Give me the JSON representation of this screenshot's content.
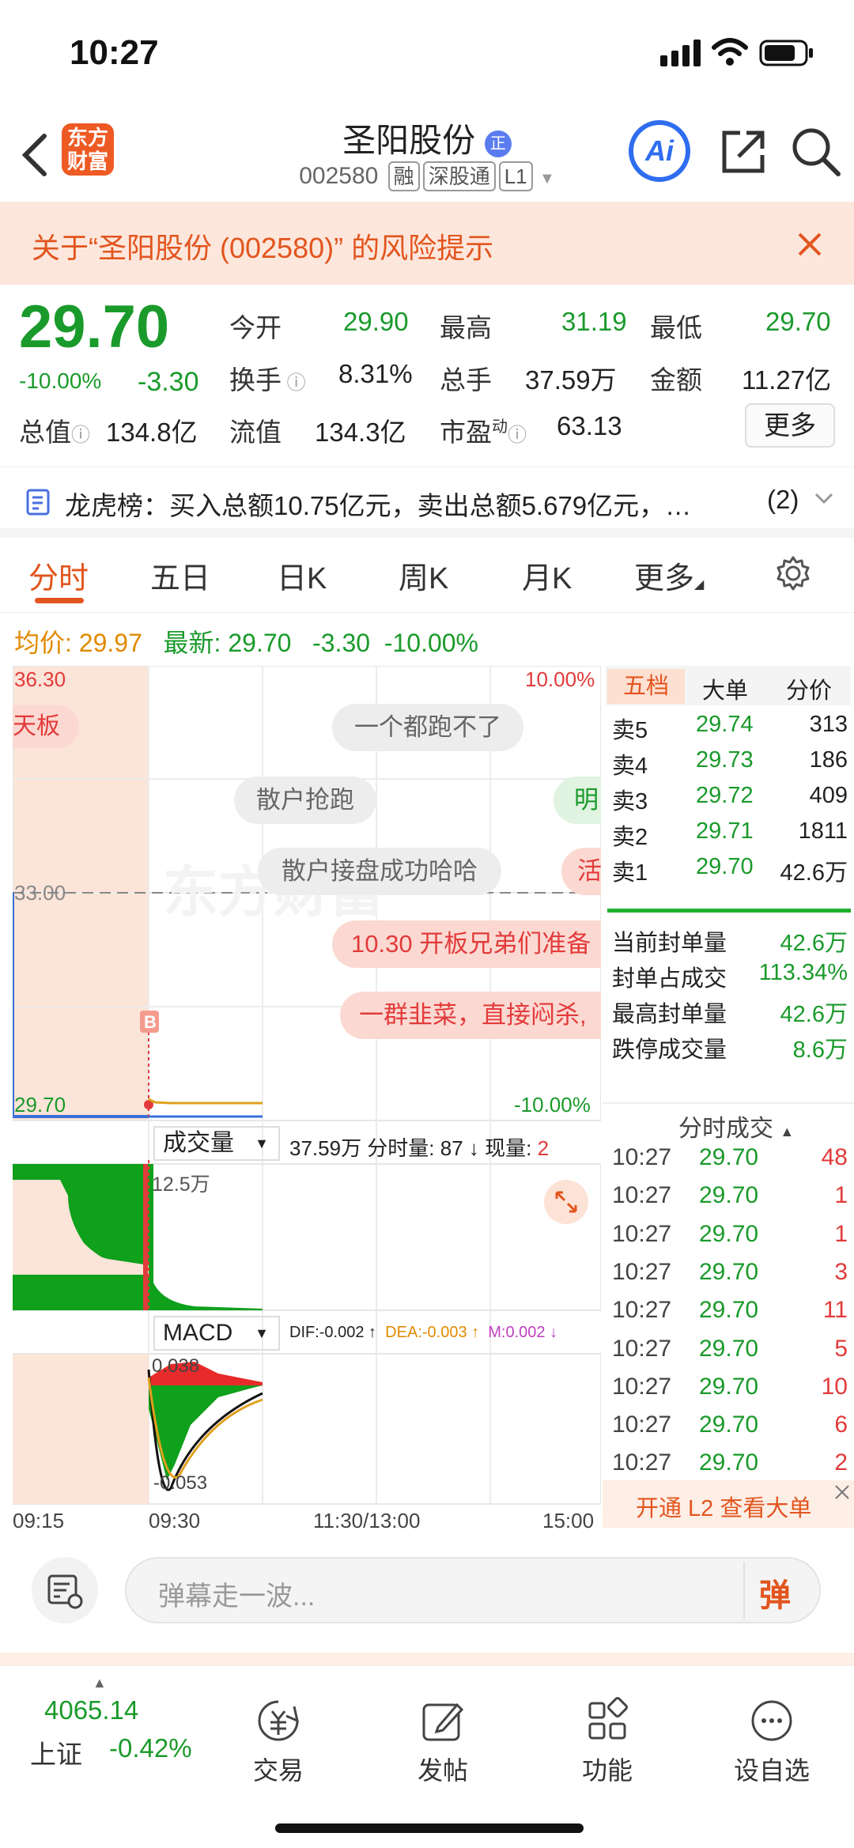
{
  "status": {
    "time": "10:27"
  },
  "header": {
    "logo": "东方财富",
    "title": "圣阳股份",
    "title_badge": "正",
    "code": "002580",
    "tags": [
      "融",
      "深股通",
      "L1"
    ],
    "ai": "Ai"
  },
  "risk": {
    "text": "关于“圣阳股份 (002580)” 的风险提示"
  },
  "quote": {
    "price": "29.70",
    "pct": "-10.00%",
    "chg": "-3.30",
    "open_l": "今开",
    "open_v": "29.90",
    "high_l": "最高",
    "high_v": "31.19",
    "low_l": "最低",
    "low_v": "29.70",
    "turn_l": "换手",
    "turn_v": "8.31%",
    "vol_l": "总手",
    "vol_v": "37.59万",
    "amt_l": "金额",
    "amt_v": "11.27亿",
    "mcap_l": "总值",
    "mcap_v": "134.8亿",
    "fcap_l": "流值",
    "fcap_v": "134.3亿",
    "pe_l": "市盈",
    "pe_sup": "动",
    "pe_v": "63.13",
    "more": "更多"
  },
  "lhb": {
    "text": "龙虎榜：买入总额10.75亿元，卖出总额5.679亿元，…",
    "count": "(2)"
  },
  "tabs": [
    "分时",
    "五日",
    "日K",
    "周K",
    "月K",
    "更多"
  ],
  "avg": {
    "avg_l": "均价:",
    "avg_v": "29.97",
    "new_l": "最新:",
    "new_v": "29.70",
    "chg": "-3.30",
    "pct": "-10.00%"
  },
  "chart": {
    "top_price": "36.30",
    "top_pct": "10.00%",
    "mid_price": "33.00",
    "bot_price": "29.70",
    "bot_pct": "-10.00%",
    "danmu": [
      "一个都跑不了",
      "散户抢跑",
      "散户接盘成功哈哈",
      "10.30 开板兄弟们准备",
      "一群韭菜，直接闷杀,",
      "天板",
      "明",
      "活"
    ],
    "marker": "B",
    "vol_sel": "成交量",
    "vol_info": "37.59万 分时量: 87 ↓ 现量: ",
    "vol_now": "2",
    "vol_max": "12.5万",
    "macd_sel": "MACD",
    "dif": "DIF:-0.002 ↑",
    "dea": "DEA:-0.003 ↑",
    "m": "M:0.002 ↓",
    "macd_top": "0.038",
    "macd_bot": "-0.053",
    "times": [
      "09:15",
      "09:30",
      "11:30/13:00",
      "15:00"
    ],
    "watermark": "东方财富"
  },
  "book": {
    "tabs": [
      "五档",
      "大单",
      "分价"
    ],
    "asks": [
      {
        "l": "卖5",
        "p": "29.74",
        "v": "313"
      },
      {
        "l": "卖4",
        "p": "29.73",
        "v": "186"
      },
      {
        "l": "卖3",
        "p": "29.72",
        "v": "409"
      },
      {
        "l": "卖2",
        "p": "29.71",
        "v": "1811"
      },
      {
        "l": "卖1",
        "p": "29.70",
        "v": "42.6万"
      }
    ],
    "stats": [
      {
        "l": "当前封单量",
        "v": "42.6万"
      },
      {
        "l": "封单占成交",
        "v": "113.34%"
      },
      {
        "l": "最高封单量",
        "v": "42.6万"
      },
      {
        "l": "跌停成交量",
        "v": "8.6万"
      }
    ],
    "ticks_title": "分时成交",
    "ticks": [
      {
        "t": "10:27",
        "p": "29.70",
        "v": "48"
      },
      {
        "t": "10:27",
        "p": "29.70",
        "v": "1"
      },
      {
        "t": "10:27",
        "p": "29.70",
        "v": "1"
      },
      {
        "t": "10:27",
        "p": "29.70",
        "v": "3"
      },
      {
        "t": "10:27",
        "p": "29.70",
        "v": "11"
      },
      {
        "t": "10:27",
        "p": "29.70",
        "v": "5"
      },
      {
        "t": "10:27",
        "p": "29.70",
        "v": "10"
      },
      {
        "t": "10:27",
        "p": "29.70",
        "v": "6"
      },
      {
        "t": "10:27",
        "p": "29.70",
        "v": "2"
      }
    ],
    "l2": "开通 L2 查看大单"
  },
  "danmu_input": {
    "placeholder": "弹幕走一波...",
    "btn": "弹"
  },
  "nav": {
    "index_v": "4065.14",
    "index_l": "上证",
    "index_pct": "-0.42%",
    "items": [
      "交易",
      "发帖",
      "功能",
      "设自选"
    ]
  }
}
